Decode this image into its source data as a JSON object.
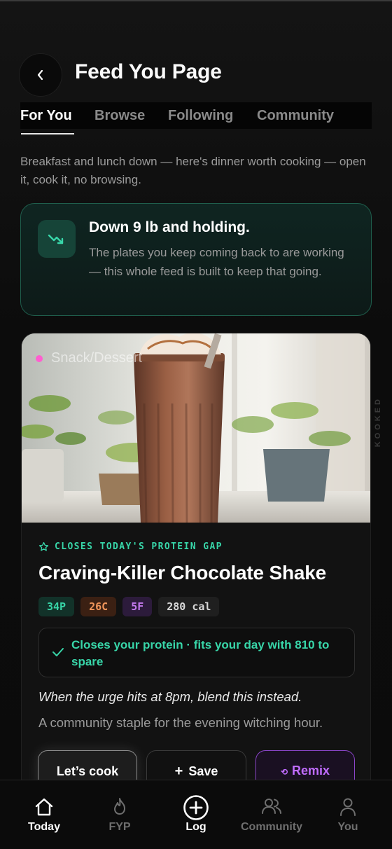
{
  "header": {
    "title": "Feed You Page",
    "back_icon": "chevron-left-icon"
  },
  "tabs": [
    {
      "label": "For You",
      "active": true
    },
    {
      "label": "Browse",
      "active": false
    },
    {
      "label": "Following",
      "active": false
    },
    {
      "label": "Community",
      "active": false
    }
  ],
  "intro": "Breakfast and lunch down — here's dinner worth cooking — open it, cook it, no browsing.",
  "progress": {
    "icon": "trending-down-icon",
    "title": "Down 9 lb and holding.",
    "body": "The plates you keep coming back to are working — this whole feed is built to keep that going."
  },
  "recipe": {
    "category": "Snack/Dessert",
    "category_color": "#ff5fd0",
    "tagline": "CLOSES TODAY'S PROTEIN GAP",
    "title": "Craving-Killer Chocolate Shake",
    "macros": {
      "protein": "34P",
      "carbs": "26C",
      "fat": "5F",
      "calories": "280 cal"
    },
    "fit_text": "Closes your protein · fits your day with 810 to spare",
    "hook": "When the urge hits at 8pm, blend this instead.",
    "description": "A community staple for the evening witching hour.",
    "buttons": {
      "cook": "Let’s cook",
      "save": "Save",
      "remix": "Remix"
    }
  },
  "watermark": "KOOKED",
  "nav": [
    {
      "label": "Today",
      "icon": "home-icon",
      "active": true
    },
    {
      "label": "FYP",
      "icon": "flame-icon",
      "active": false
    },
    {
      "label": "Log",
      "icon": "plus-circle-icon",
      "active": false
    },
    {
      "label": "Community",
      "icon": "users-icon",
      "active": false
    },
    {
      "label": "You",
      "icon": "user-icon",
      "active": false
    }
  ],
  "colors": {
    "accent_green": "#38d6a9",
    "accent_purple": "#c06cff",
    "background": "#0e0e0e"
  }
}
